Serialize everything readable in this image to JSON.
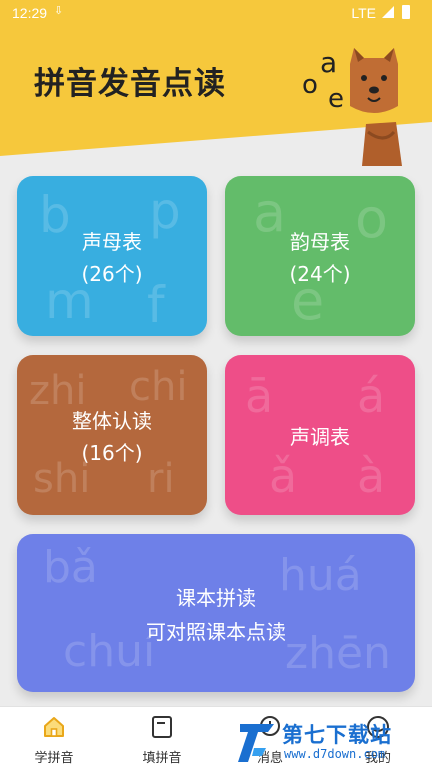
{
  "status_bar": {
    "time": "12:29",
    "network": "LTE"
  },
  "header": {
    "title": "拼音发音点读",
    "mascot_letters": [
      "o",
      "a",
      "e"
    ]
  },
  "cards": [
    {
      "id": "initials",
      "title": "声母表",
      "subtitle": "(26个)",
      "color": "#38aee0",
      "deco": [
        "b",
        "p",
        "m",
        "f"
      ]
    },
    {
      "id": "finals",
      "title": "韵母表",
      "subtitle": "(24个)",
      "color": "#63bc6a",
      "deco": [
        "a",
        "o",
        "e"
      ]
    },
    {
      "id": "whole",
      "title": "整体认读",
      "subtitle": "(16个)",
      "color": "#b4683d",
      "deco": [
        "zhi",
        "chi",
        "shi",
        "ri"
      ]
    },
    {
      "id": "tones",
      "title": "声调表",
      "subtitle": "",
      "color": "#ee4e88",
      "deco": [
        "ā",
        "á",
        "ǎ",
        "à"
      ]
    },
    {
      "id": "textbook",
      "title": "课本拼读",
      "subtitle": "可对照课本点读",
      "color": "#6e80e8",
      "deco": [
        "bǎ",
        "huá",
        "chuí",
        "zhēn"
      ]
    }
  ],
  "nav": {
    "items": [
      {
        "label": "学拼音",
        "icon": "home-icon",
        "active": true
      },
      {
        "label": "填拼音",
        "icon": "note-icon",
        "active": false
      },
      {
        "label": "消息",
        "icon": "message-icon",
        "active": false
      },
      {
        "label": "我的",
        "icon": "profile-icon",
        "active": false
      }
    ]
  },
  "watermark": {
    "title": "第七下载站",
    "url": "www.d7down.com"
  },
  "colors": {
    "header_yellow": "#f6c83c",
    "background": "#ececec",
    "brand_blue": "#1a6fd0"
  }
}
